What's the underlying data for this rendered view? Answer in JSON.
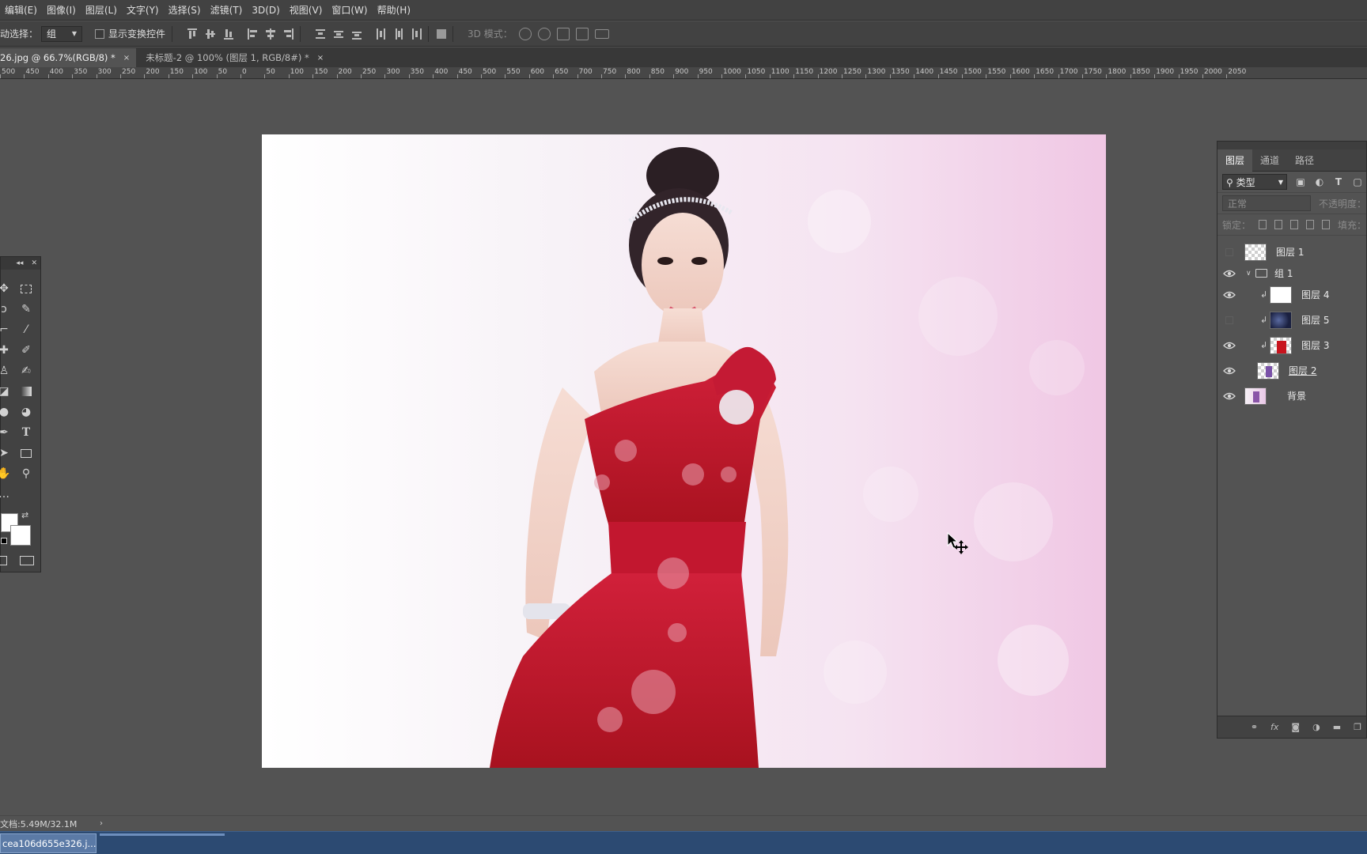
{
  "menu": [
    "编辑(E)",
    "图像(I)",
    "图层(L)",
    "文字(Y)",
    "选择(S)",
    "滤镜(T)",
    "3D(D)",
    "视图(V)",
    "窗口(W)",
    "帮助(H)"
  ],
  "options": {
    "auto_select_label": "动选择：",
    "auto_select_value": "组",
    "show_transform_label": "显示变换控件",
    "mode3d_label": "3D 模式："
  },
  "tabs": [
    {
      "label": "26.jpg @ 66.7%(RGB/8) *",
      "close": "×"
    },
    {
      "label": "未标题-2 @ 100% (图层 1, RGB/8#) *",
      "close": "×"
    }
  ],
  "ruler_labels": [
    "500",
    "450",
    "400",
    "350",
    "300",
    "250",
    "200",
    "150",
    "100",
    "50",
    "0",
    "50",
    "100",
    "150",
    "200",
    "250",
    "300",
    "350",
    "400",
    "450",
    "500",
    "550",
    "600",
    "650",
    "700",
    "750",
    "800",
    "850",
    "900",
    "950",
    "1000",
    "1050",
    "1100",
    "1150",
    "1200",
    "1250",
    "1300",
    "1350",
    "1400",
    "1450",
    "1500",
    "1550",
    "1600",
    "1650",
    "1700",
    "1750",
    "1800",
    "1850",
    "1900",
    "1950",
    "2000",
    "2050"
  ],
  "layers_panel": {
    "tabs": [
      "图层",
      "通道",
      "路径"
    ],
    "kind_filter": "类型",
    "blend_mode": "正常",
    "opacity_label": "不透明度：",
    "lock_label": "锁定：",
    "fill_label": "填充：",
    "layers": [
      {
        "name": "图层 1",
        "visible": false,
        "indent": 0,
        "clipped": false
      },
      {
        "name": "组 1",
        "visible": true,
        "indent": 0,
        "group": true
      },
      {
        "name": "图层 4",
        "visible": true,
        "indent": 1,
        "clipped": true
      },
      {
        "name": "图层 5",
        "visible": false,
        "indent": 1,
        "clipped": true
      },
      {
        "name": "图层 3",
        "visible": true,
        "indent": 1,
        "clipped": true
      },
      {
        "name": "图层 2",
        "visible": true,
        "indent": 1,
        "clipped": false
      },
      {
        "name": "背景",
        "visible": true,
        "indent": 0,
        "clipped": false
      }
    ],
    "footer_icons": [
      "link-icon",
      "fx-icon",
      "mask-icon",
      "adjustment-icon",
      "folder-icon",
      "new-layer-icon"
    ]
  },
  "status": {
    "doc": "文档:5.49M/32.1M",
    "arrow": "›"
  },
  "taskbar": {
    "item": "cea106d655e326.j..."
  }
}
